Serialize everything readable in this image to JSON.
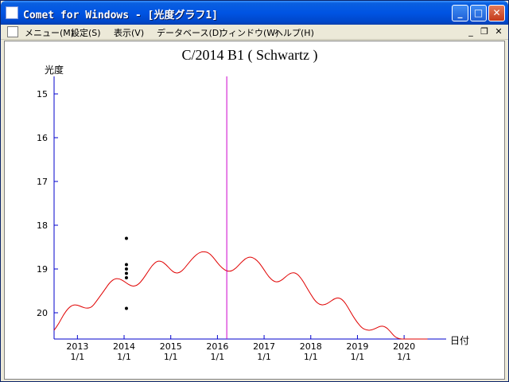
{
  "window": {
    "title": "Comet for Windows - [光度グラフ1]",
    "controls": {
      "minimize": "_",
      "maximize": "□",
      "close": "✕"
    },
    "mdi": {
      "minimize": "_",
      "restore": "❐",
      "close": "✕"
    }
  },
  "menu": [
    {
      "label": "メニュー(M)"
    },
    {
      "label": "設定(S)"
    },
    {
      "label": "表示(V)"
    },
    {
      "label": "データベース(D)"
    },
    {
      "label": "ウィンドウ(W)"
    },
    {
      "label": "ヘルプ(H)"
    }
  ],
  "chart_data": {
    "type": "line",
    "title": "C/2014 B1 ( Schwartz )",
    "ylabel": "光度",
    "xlabel": "日付",
    "ylim": [
      20.6,
      14.6
    ],
    "y_inverted": true,
    "yticks": [
      15,
      16,
      17,
      18,
      19,
      20
    ],
    "xlim": [
      2012.5,
      2020.85
    ],
    "xticks": [
      {
        "x": 2013,
        "year": "2013",
        "date": "1/1"
      },
      {
        "x": 2014,
        "year": "2014",
        "date": "1/1"
      },
      {
        "x": 2015,
        "year": "2015",
        "date": "1/1"
      },
      {
        "x": 2016,
        "year": "2016",
        "date": "1/1"
      },
      {
        "x": 2017,
        "year": "2017",
        "date": "1/1"
      },
      {
        "x": 2018,
        "year": "2018",
        "date": "1/1"
      },
      {
        "x": 2019,
        "year": "2019",
        "date": "1/1"
      },
      {
        "x": 2020,
        "year": "2020",
        "date": "1/1"
      }
    ],
    "current_date_x": 2016.2,
    "colors": {
      "axis": "#0000cc",
      "curve": "#e00000",
      "marker": "#cc00cc",
      "points": "#000000"
    },
    "series": [
      {
        "kind": "predicted",
        "x": [
          2012.5,
          2012.6,
          2012.7,
          2012.8,
          2012.9,
          2013.0,
          2013.1,
          2013.2,
          2013.3,
          2013.4,
          2013.5,
          2013.6,
          2013.7,
          2013.8,
          2013.9,
          2014.0,
          2014.1,
          2014.2,
          2014.3,
          2014.4,
          2014.5,
          2014.6,
          2014.7,
          2014.8,
          2014.9,
          2015.0,
          2015.1,
          2015.2,
          2015.3,
          2015.4,
          2015.5,
          2015.6,
          2015.7,
          2015.8,
          2015.9,
          2016.0,
          2016.1,
          2016.2,
          2016.3,
          2016.4,
          2016.5,
          2016.6,
          2016.7,
          2016.8,
          2016.9,
          2017.0,
          2017.1,
          2017.2,
          2017.3,
          2017.4,
          2017.5,
          2017.6,
          2017.7,
          2017.8,
          2017.9,
          2018.0,
          2018.1,
          2018.2,
          2018.3,
          2018.4,
          2018.5,
          2018.6,
          2018.7,
          2018.8,
          2018.9,
          2019.0,
          2019.1,
          2019.2,
          2019.3,
          2019.4,
          2019.5,
          2019.6,
          2019.7,
          2019.8,
          2019.9,
          2020.0,
          2020.1,
          2020.2,
          2020.3,
          2020.4,
          2020.5
        ],
        "y": [
          20.4,
          20.25,
          20.05,
          19.9,
          19.82,
          19.82,
          19.87,
          19.9,
          19.88,
          19.75,
          19.6,
          19.45,
          19.3,
          19.22,
          19.22,
          19.28,
          19.36,
          19.4,
          19.36,
          19.24,
          19.08,
          18.92,
          18.82,
          18.82,
          18.9,
          19.02,
          19.1,
          19.08,
          18.98,
          18.84,
          18.72,
          18.63,
          18.6,
          18.62,
          18.72,
          18.86,
          18.98,
          19.05,
          19.05,
          18.98,
          18.86,
          18.76,
          18.72,
          18.76,
          18.86,
          19.02,
          19.18,
          19.28,
          19.3,
          19.24,
          19.14,
          19.08,
          19.1,
          19.22,
          19.4,
          19.58,
          19.74,
          19.82,
          19.82,
          19.76,
          19.68,
          19.65,
          19.72,
          19.88,
          20.07,
          20.23,
          20.35,
          20.4,
          20.4,
          20.35,
          20.3,
          20.32,
          20.42,
          20.55,
          20.62,
          20.65,
          20.65,
          20.65,
          20.65,
          20.65,
          20.65
        ]
      },
      {
        "kind": "observed",
        "x": [
          2014.05,
          2014.05,
          2014.05,
          2014.05,
          2014.05,
          2014.05
        ],
        "y": [
          18.3,
          18.9,
          19.0,
          19.1,
          19.2,
          19.9
        ]
      }
    ]
  }
}
